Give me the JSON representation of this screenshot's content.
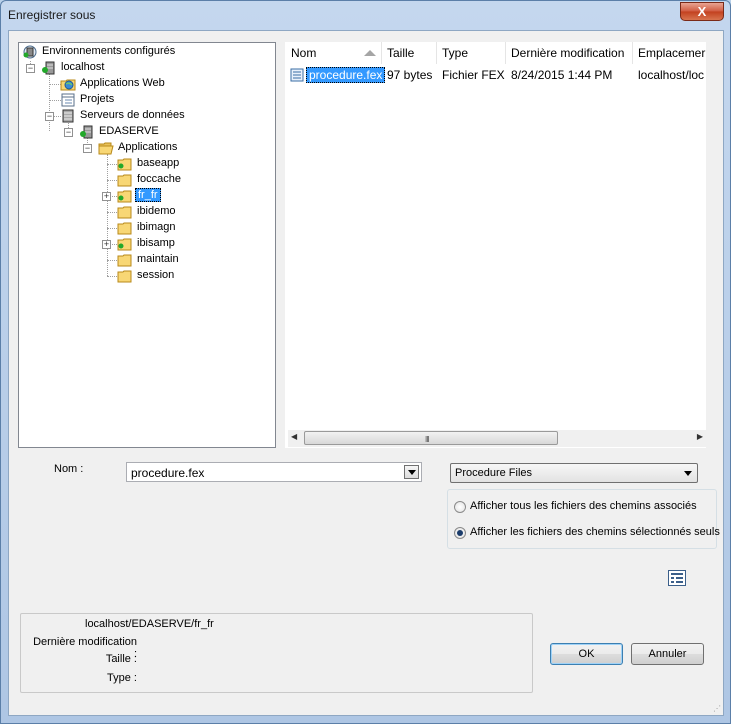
{
  "window": {
    "title": "Enregistrer sous",
    "close_symbol": "X"
  },
  "tree": {
    "root": "Environnements configurés",
    "host": "localhost",
    "web_apps": "Applications Web",
    "projects": "Projets",
    "data_servers": "Serveurs de données",
    "server": "EDASERVE",
    "applications": "Applications",
    "folders": [
      "baseapp",
      "foccache",
      "fr_fr",
      "ibidemo",
      "ibimagn",
      "ibisamp",
      "maintain",
      "session"
    ],
    "selected": "fr_fr"
  },
  "list": {
    "columns": [
      "Nom",
      "Taille",
      "Type",
      "Dernière modification",
      "Emplacemer"
    ],
    "rows": [
      {
        "name": "procedure.fex",
        "size": "97 bytes",
        "type": "Fichier FEX",
        "modified": "8/24/2015 1:44 PM",
        "location": "localhost/loc"
      }
    ],
    "scroll_grip": "III"
  },
  "form": {
    "name_label": "Nom :",
    "name_value": "procedure.fex",
    "file_type": "Procedure Files",
    "radio_all": "Afficher tous les fichiers des chemins associés",
    "radio_selected": "Afficher les fichiers des chemins sélectionnés seuls",
    "radio_checked": "selected"
  },
  "info": {
    "path": "localhost/EDASERVE/fr_fr",
    "modified_label": "Dernière modification :",
    "size_label": "Taille :",
    "type_label": "Type :"
  },
  "buttons": {
    "ok": "OK",
    "cancel": "Annuler"
  },
  "colors": {
    "selection": "#3399ff",
    "title_close": "#c2401e"
  }
}
